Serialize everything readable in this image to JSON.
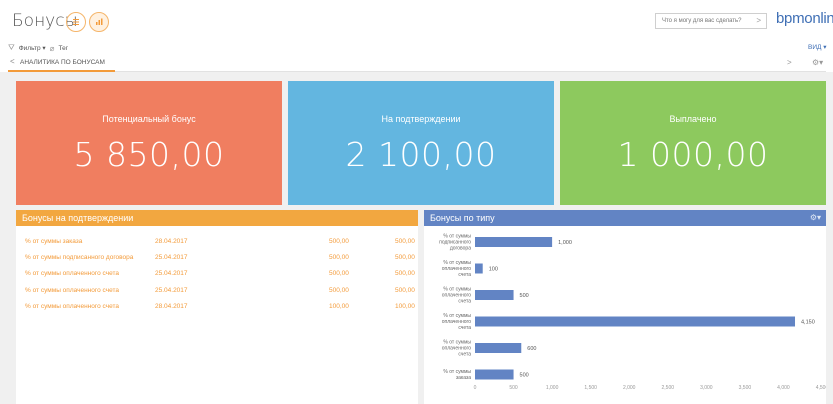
{
  "header": {
    "title": "Бонусы",
    "help_placeholder": "Что я могу для вас сделать?",
    "help_arrow": ">",
    "logo": "bpmonline"
  },
  "toolbar": {
    "filter_label": "Фильтр ▾",
    "tag_label": "Тег",
    "view_label": "ВИД ▾"
  },
  "tabs": {
    "active_label": "АНАЛИТИКА ПО БОНУСАМ",
    "prev": "<",
    "next": ">"
  },
  "tiles": [
    {
      "caption": "Потенциальный бонус",
      "value": "5 850,00",
      "color": "#f07e60"
    },
    {
      "caption": "На подтверждении",
      "value": "2 100,00",
      "color": "#63b6e0"
    },
    {
      "caption": "Выплачено",
      "value": "1 000,00",
      "color": "#8dc95e"
    }
  ],
  "pending": {
    "title": "Бонусы на подтверждении",
    "rows": [
      {
        "name": "% от суммы заказа",
        "date": "28.04.2017",
        "amount": "500,00",
        "total": "500,00"
      },
      {
        "name": "% от суммы подписанного договора",
        "date": "25.04.2017",
        "amount": "500,00",
        "total": "500,00"
      },
      {
        "name": "% от суммы оплаченного счета",
        "date": "25.04.2017",
        "amount": "500,00",
        "total": "500,00"
      },
      {
        "name": "% от суммы оплаченного счета",
        "date": "25.04.2017",
        "amount": "500,00",
        "total": "500,00"
      },
      {
        "name": "% от суммы оплаченного счета",
        "date": "28.04.2017",
        "amount": "100,00",
        "total": "100,00"
      }
    ]
  },
  "by_type": {
    "title": "Бонусы по типу"
  },
  "chart_data": {
    "type": "bar",
    "orientation": "horizontal",
    "title": "Бонусы по типу",
    "categories": [
      "% от суммы подписанного договора",
      "% от суммы оплаченного счета",
      "% от суммы оплаченного счета",
      "% от суммы оплаченного счета",
      "% от суммы оплаченного счета",
      "% от суммы заказа"
    ],
    "category_lines": [
      [
        "% от суммы",
        "подписанного",
        "договора"
      ],
      [
        "% от суммы",
        "оплаченного",
        "счета"
      ],
      [
        "% от суммы",
        "оплаченного",
        "счета"
      ],
      [
        "% от суммы",
        "оплаченного",
        "счета"
      ],
      [
        "% от суммы",
        "оплаченного",
        "счета"
      ],
      [
        "% от суммы",
        "заказа"
      ]
    ],
    "values": [
      1000,
      100,
      500,
      4150,
      600,
      500
    ],
    "data_labels": [
      "1,000",
      "100",
      "500",
      "4,150",
      "600",
      "500"
    ],
    "xlim": [
      0,
      4500
    ],
    "xticks": [
      "0",
      "500",
      "1,000",
      "1,500",
      "2,000",
      "2,500",
      "3,000",
      "3,500",
      "4,000",
      "4,500"
    ],
    "xtick_values": [
      0,
      500,
      1000,
      1500,
      2000,
      2500,
      3000,
      3500,
      4000,
      4500
    ],
    "bar_color": "#6284c4",
    "grid": false
  }
}
